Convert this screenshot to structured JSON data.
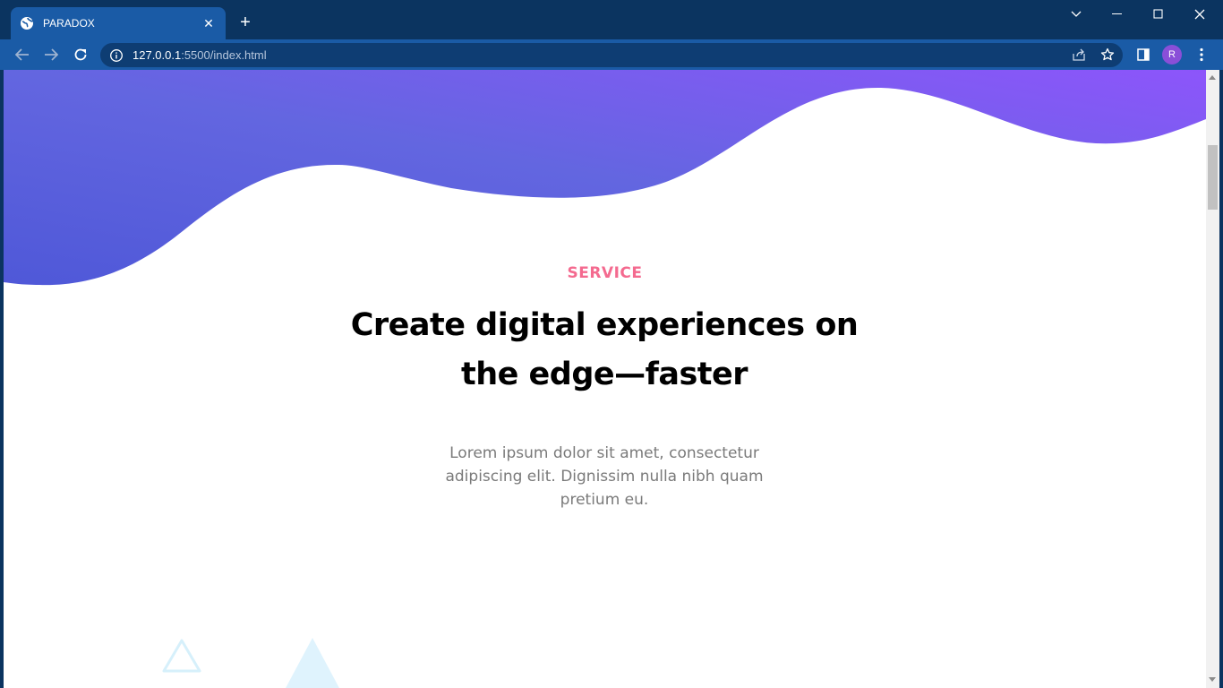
{
  "browser": {
    "tab": {
      "title": "PARADOX",
      "close_glyph": "✕"
    },
    "new_tab_glyph": "+",
    "address": {
      "host": "127.0.0.1",
      "path": ":5500/index.html"
    },
    "profile_initial": "R"
  },
  "page": {
    "eyebrow": "SERVICE",
    "heading": "Create digital experiences on the edge—faster",
    "description": "Lorem ipsum dolor sit amet, consectetur adipiscing elit. Dignissim nulla nibh quam pretium eu."
  },
  "colors": {
    "wave_start": "#4f58d8",
    "wave_end": "#8d55fb",
    "eyebrow": "#f46a8f",
    "triangle": "#dff3fd"
  },
  "icons": {
    "favicon": "globe-icon",
    "back": "arrow-left-icon",
    "forward": "arrow-right-icon",
    "reload": "reload-icon",
    "site_info": "info-icon",
    "share": "share-icon",
    "bookmark": "star-icon",
    "side_panel": "side-panel-icon",
    "menu": "kebab-menu-icon"
  }
}
